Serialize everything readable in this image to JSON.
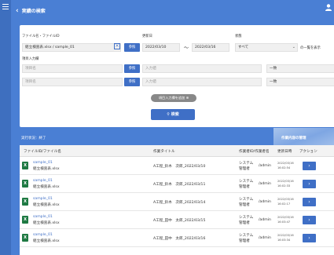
{
  "header": {
    "title": "実績の検索"
  },
  "form": {
    "filename_label": "ファイル名・ファイルID",
    "filename_value": "組立検査表.xlsx / sample_01",
    "ref_button": "参照",
    "updated_label": "更新日",
    "date_from": "2022/03/10",
    "date_sep": "～",
    "date_to": "2022/03/16",
    "state_label": "状態",
    "state_value": "すべて",
    "state_suffix": "の一覧を表示",
    "item_input_label": "項目入力欄",
    "item_rows": [
      {
        "name_placeholder": "項目名",
        "ref_button": "参照",
        "value_placeholder": "入力値",
        "match": "一致"
      },
      {
        "name_placeholder": "項目名",
        "ref_button": "参照",
        "value_placeholder": "入力値",
        "match": "一致"
      }
    ],
    "add_field_button": "項目入力欄を追加 ⊕",
    "search_button": "検索"
  },
  "progress": {
    "status": "実行状況：終了",
    "banner_text": "作業内容の管理"
  },
  "table": {
    "headers": [
      "ファイルID/ファイル名",
      "作業タイトル",
      "作業者ID/作業者名",
      "更新日時",
      "アクション"
    ],
    "rows": [
      {
        "file_id": "sample_01",
        "file_name": "組立検査表.xlsx",
        "title": "A工程_鈴木　次郎_2022/03/10",
        "user_name1": "システム",
        "user_name2": "管理者",
        "user_id": "/admin",
        "date": "2022/03/16",
        "time": "16:02:54"
      },
      {
        "file_id": "sample_01",
        "file_name": "組立検査表.xlsx",
        "title": "A工程_鈴木　次郎_2022/03/11",
        "user_name1": "システム",
        "user_name2": "管理者",
        "user_id": "/admin",
        "date": "2022/03/16",
        "time": "16:02:33"
      },
      {
        "file_id": "sample_01",
        "file_name": "組立検査表.xlsx",
        "title": "A工程_鈴木　次郎_2022/03/14",
        "user_name1": "システム",
        "user_name2": "管理者",
        "user_id": "/admin",
        "date": "2022/03/16",
        "time": "16:02:17"
      },
      {
        "file_id": "sample_01",
        "file_name": "組立検査表.xlsx",
        "title": "A工程_田中　太郎_2022/03/15",
        "user_name1": "システム",
        "user_name2": "管理者",
        "user_id": "/admin",
        "date": "2022/03/16",
        "time": "16:03:47"
      },
      {
        "file_id": "sample_01",
        "file_name": "組立検査表.xlsx",
        "title": "A工程_田中　太郎_2022/03/16",
        "user_name1": "システム",
        "user_name2": "管理者",
        "user_id": "/admin",
        "date": "2022/03/16",
        "time": "16:03:34"
      }
    ]
  }
}
